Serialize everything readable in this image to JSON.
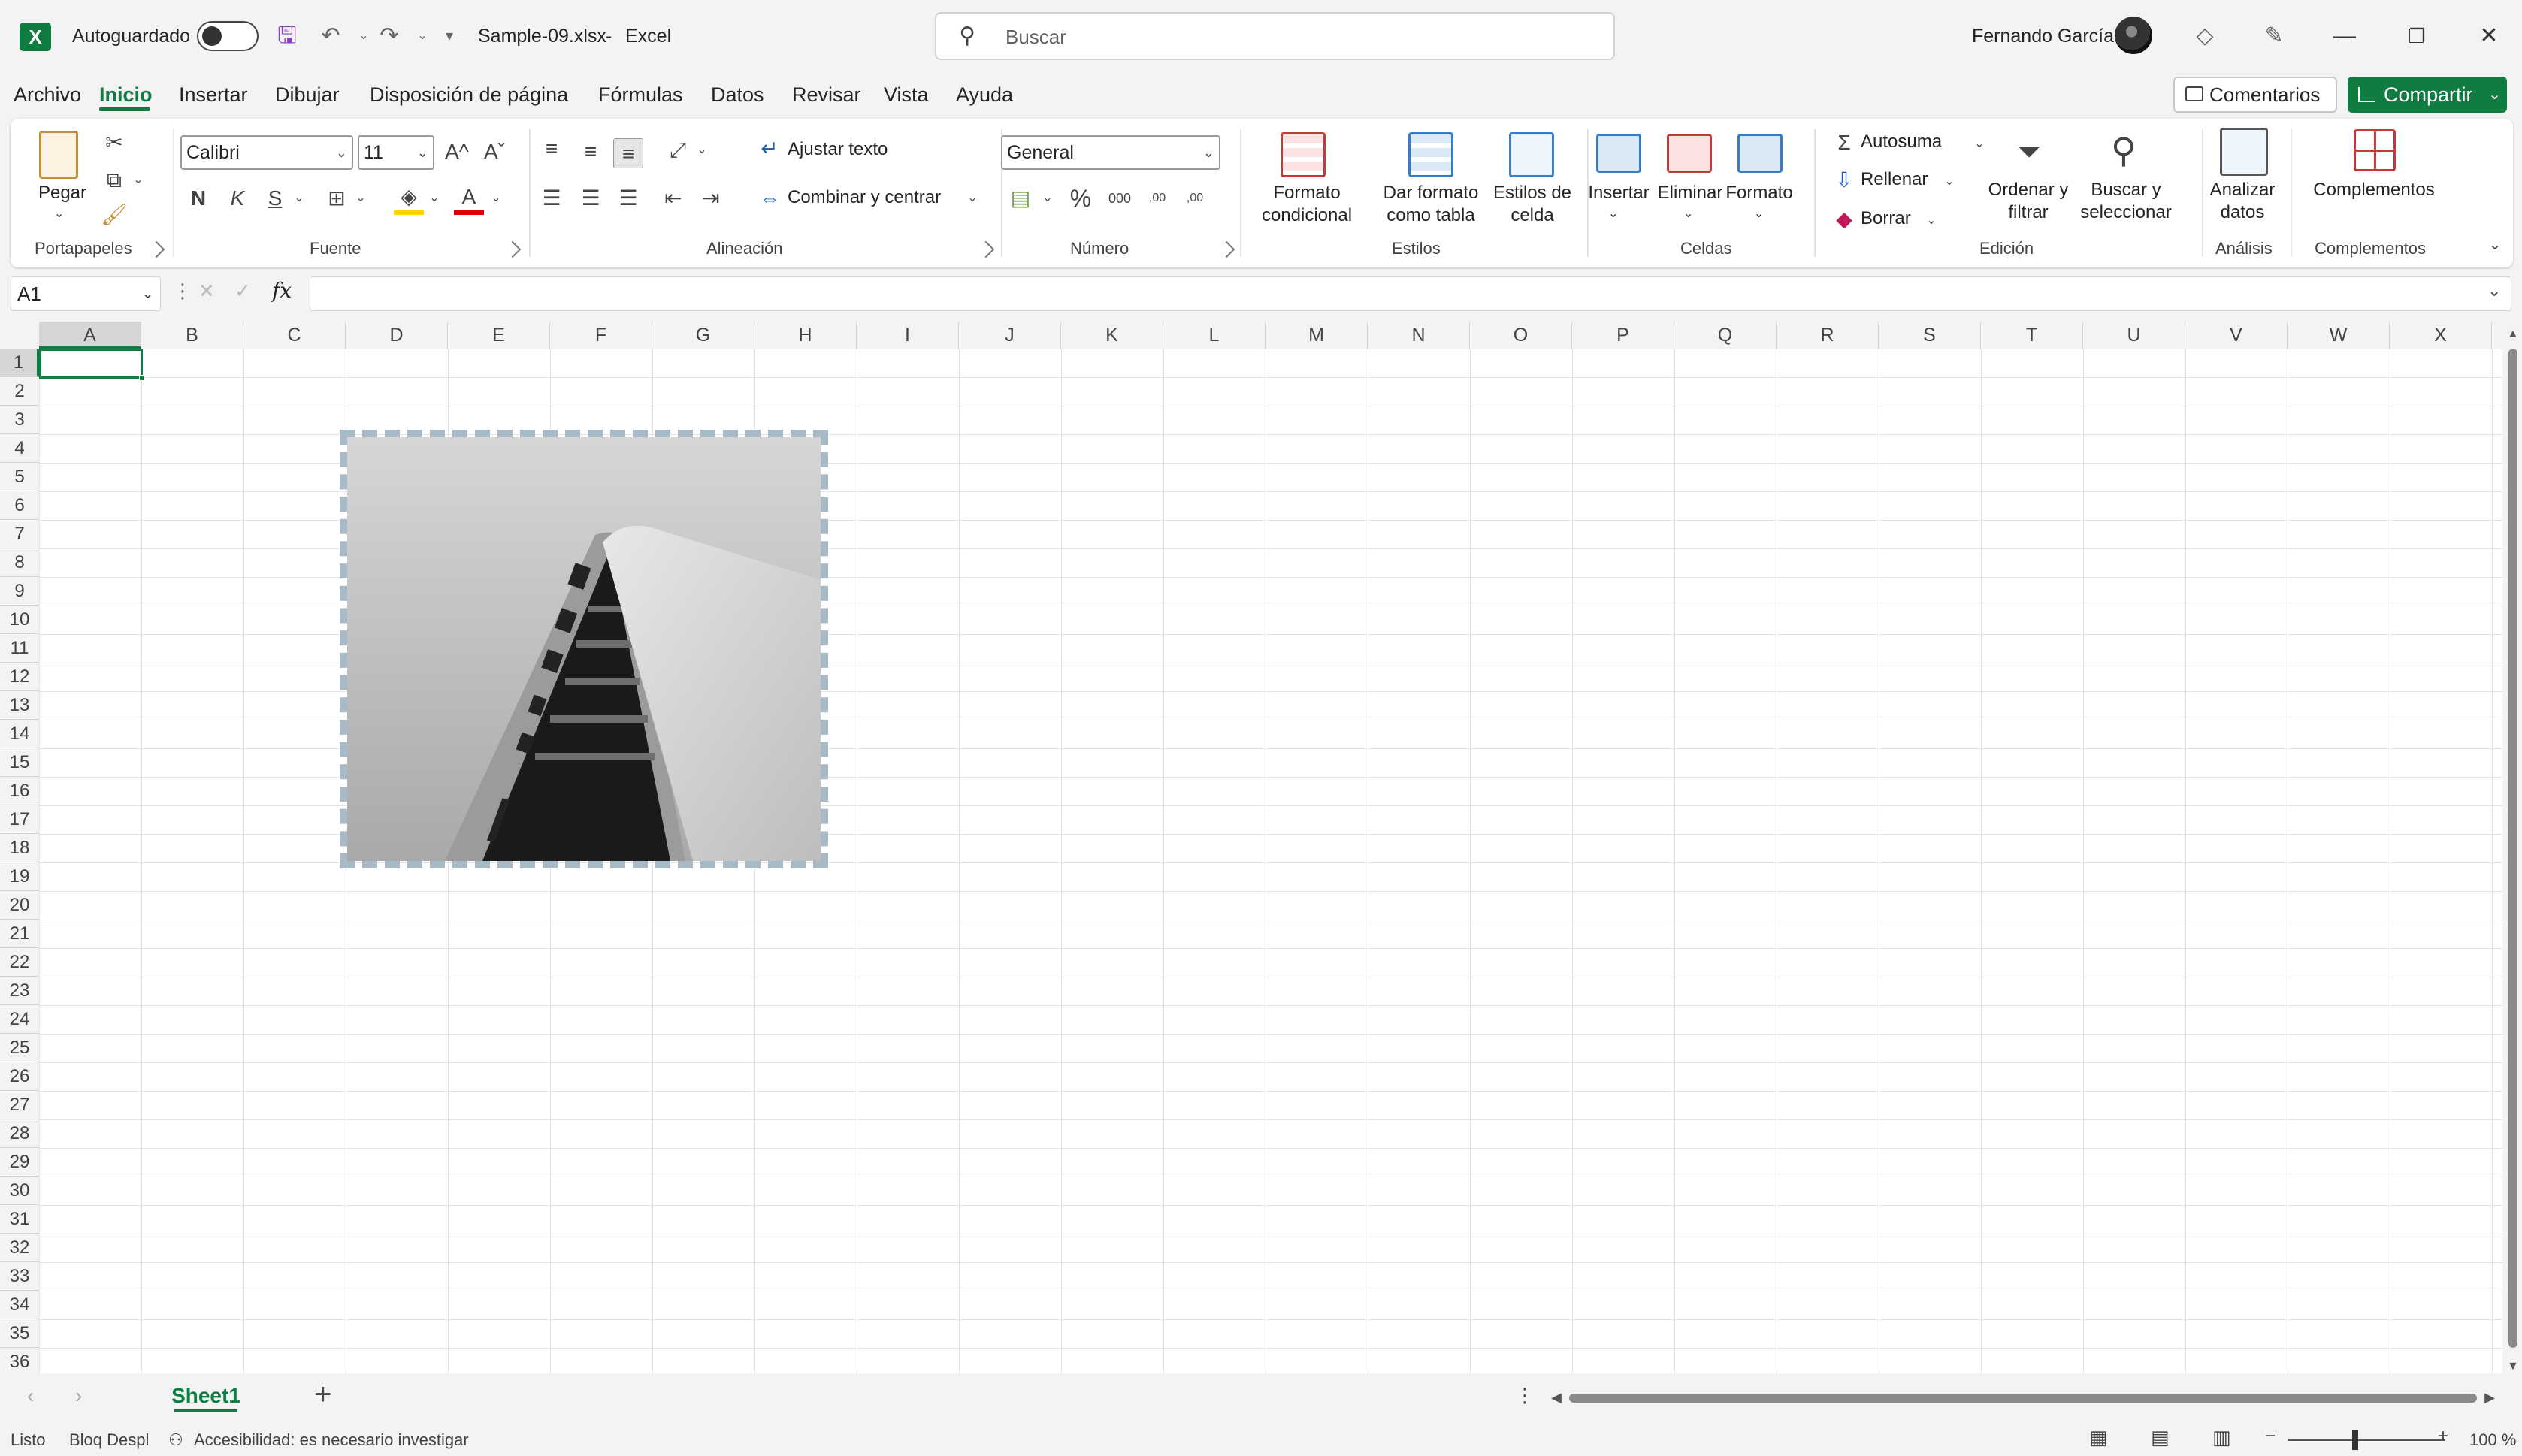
{
  "titlebar": {
    "autosave_label": "Autoguardado",
    "filename": "Sample-09.xlsx",
    "separator": "-",
    "app": "Excel",
    "search_placeholder": "Buscar",
    "user": "Fernando García"
  },
  "tabs": [
    "Archivo",
    "Inicio",
    "Insertar",
    "Dibujar",
    "Disposición de página",
    "Fórmulas",
    "Datos",
    "Revisar",
    "Vista",
    "Ayuda"
  ],
  "actions": {
    "comments": "Comentarios",
    "share": "Compartir"
  },
  "ribbon": {
    "clipboard": {
      "paste": "Pegar",
      "label": "Portapapeles"
    },
    "font": {
      "name": "Calibri",
      "size": "11",
      "grow": "A^",
      "shrink": "Aˇ",
      "bold": "N",
      "italic": "K",
      "underline": "S",
      "color_letter": "A",
      "label": "Fuente"
    },
    "alignment": {
      "wrap": "Ajustar texto",
      "merge": "Combinar y centrar",
      "label": "Alineación"
    },
    "number": {
      "format": "General",
      "percent": "%",
      "thousands": "000",
      "inc_dec": ",00",
      "dec_dec": ",00",
      "label": "Número"
    },
    "styles": {
      "conditional_l1": "Formato",
      "conditional_l2": "condicional",
      "table_l1": "Dar formato",
      "table_l2": "como tabla",
      "cell_l1": "Estilos de",
      "cell_l2": "celda",
      "label": "Estilos"
    },
    "cells": {
      "insert": "Insertar",
      "delete": "Eliminar",
      "format": "Formato",
      "label": "Celdas"
    },
    "editing": {
      "autosum": "Autosuma",
      "fill": "Rellenar",
      "clear": "Borrar",
      "sort_l1": "Ordenar y",
      "sort_l2": "filtrar",
      "find_l1": "Buscar y",
      "find_l2": "seleccionar",
      "label": "Edición"
    },
    "analysis": {
      "analyze_l1": "Analizar",
      "analyze_l2": "datos",
      "label": "Análisis"
    },
    "addins": {
      "addins": "Complementos",
      "label": "Complementos"
    }
  },
  "formula_bar": {
    "name_box": "A1",
    "fx": "fx",
    "value": ""
  },
  "columns": [
    "A",
    "B",
    "C",
    "D",
    "E",
    "F",
    "G",
    "H",
    "I",
    "J",
    "K",
    "L",
    "M",
    "N",
    "O",
    "P",
    "Q",
    "R",
    "S",
    "T",
    "U",
    "V",
    "W",
    "X"
  ],
  "rows": [
    "1",
    "2",
    "3",
    "4",
    "5",
    "6",
    "7",
    "8",
    "9",
    "10",
    "11",
    "12",
    "13",
    "14",
    "15",
    "16",
    "17",
    "18",
    "19",
    "20",
    "21",
    "22",
    "23",
    "24",
    "25",
    "26",
    "27",
    "28",
    "29",
    "30",
    "31",
    "32",
    "33",
    "34",
    "35",
    "36"
  ],
  "selected_cell": "A1",
  "sheets": [
    "Sheet1"
  ],
  "status": {
    "ready": "Listo",
    "scroll_lock": "Bloq Despl",
    "accessibility": "Accesibilidad: es necesario investigar",
    "zoom": "100 %"
  },
  "colors": {
    "accent": "#107c41",
    "picture_border": "#a9bac7"
  }
}
